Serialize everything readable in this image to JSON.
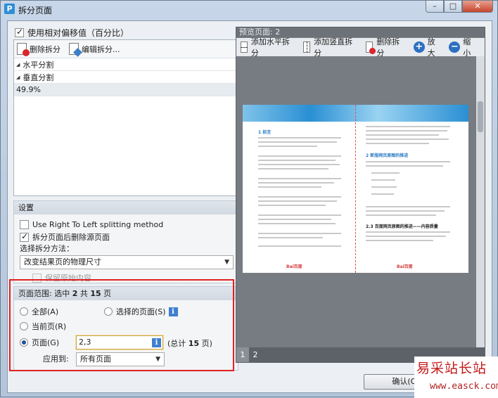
{
  "window": {
    "title": "拆分页面",
    "app_icon_letter": "P"
  },
  "left": {
    "use_relative_offset_label": "使用相对偏移值（百分比）",
    "toolbar": {
      "delete_split": "删除拆分",
      "edit_split": "编辑拆分..."
    },
    "tree": [
      {
        "label": "水平分割"
      },
      {
        "label": "垂直分割"
      },
      {
        "label": "49.9%"
      }
    ]
  },
  "settings": {
    "header": "设置",
    "rtl_label": "Use Right To Left splitting method",
    "delete_source_label": "拆分页面后删除源页面",
    "method_label": "选择拆分方法：",
    "method_value": "改变结果页的物理尺寸",
    "keep_original_label": "保留原始内容"
  },
  "range": {
    "header_prefix": "页面范围: 选中",
    "header_selected": "2",
    "header_mid": "共",
    "header_total": "15",
    "header_suffix": "页",
    "all": "全部(A)",
    "selected_pages": "选择的页面(S)",
    "current_page": "当前页(R)",
    "pages": "页面(G)",
    "pages_value": "2,3",
    "total_prefix": "(总计",
    "total_count": "15",
    "total_suffix": "页)",
    "apply_to_label": "应用到:",
    "apply_to_value": "所有页面"
  },
  "preview": {
    "title": "预览页面: 2",
    "toolbar": {
      "add_horizontal": "添加水平拆分",
      "add_vertical": "添加竖直拆分",
      "delete_split": "删除拆分",
      "zoom_in": "放大",
      "zoom_out": "缩小"
    },
    "doc": {
      "left_heading": "1 前言",
      "right_heading": "2 新版网页原图的推进",
      "right_subheading": "2.3 百度网页原图的推进——内容质量",
      "logo": "Bai百度"
    },
    "tabs": [
      "1",
      "2"
    ]
  },
  "footer": {
    "ok_button": "确认(O)"
  },
  "watermark": {
    "title": "易采站长站",
    "url": "www.easck.com"
  },
  "colors": {
    "highlight": "#e02020",
    "accent": "#2c6fc0"
  }
}
